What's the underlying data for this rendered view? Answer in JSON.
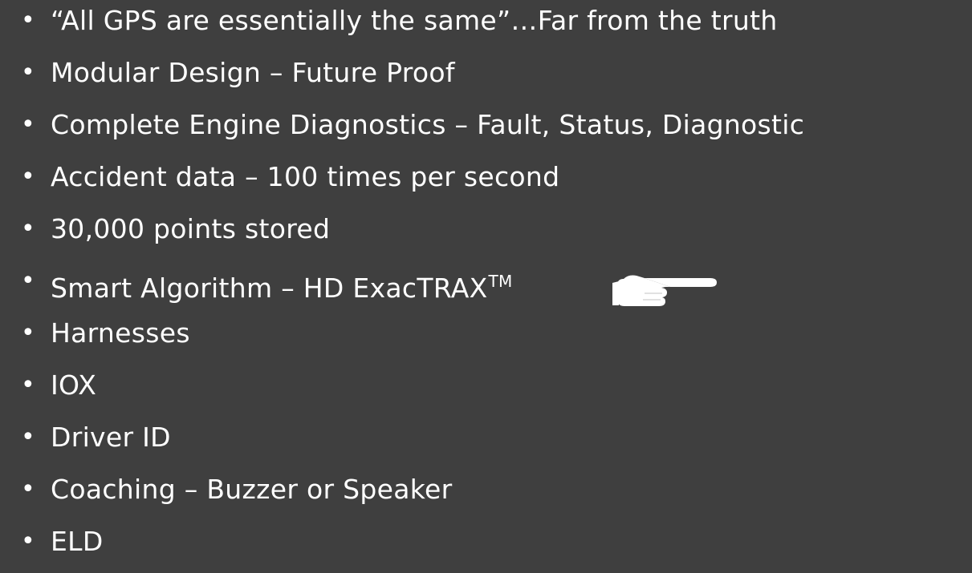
{
  "slide": {
    "bullets": [
      {
        "text": "“All GPS are essentially the same”…Far from the truth"
      },
      {
        "text": "Modular Design – Future Proof"
      },
      {
        "text": "Complete Engine Diagnostics – Fault, Status, Diagnostic"
      },
      {
        "text": "Accident data – 100 times per second"
      },
      {
        "text": "30,000 points stored"
      },
      {
        "text": "Smart Algorithm – HD ExacTRAX",
        "superscript": "TM",
        "icon": "pointing-hand-icon"
      },
      {
        "text": "Harnesses"
      },
      {
        "text": "IOX"
      },
      {
        "text": "Driver ID"
      },
      {
        "text": "Coaching – Buzzer or Speaker"
      },
      {
        "text": "ELD"
      }
    ],
    "bullet_symbol": "•",
    "colors": {
      "background": "#3f3f3f",
      "text": "#ffffff"
    }
  }
}
